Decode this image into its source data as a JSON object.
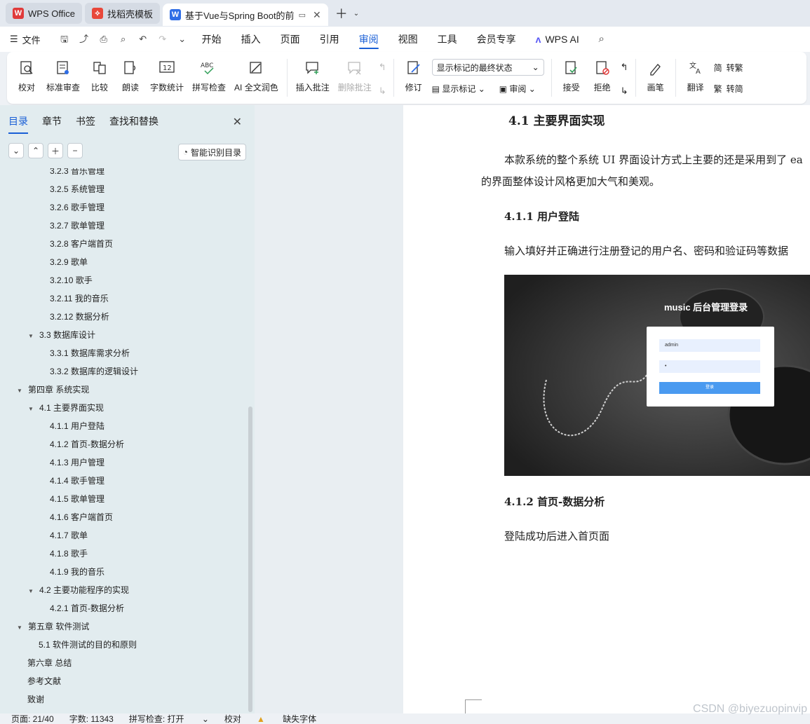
{
  "tabs": [
    {
      "label": "WPS Office",
      "icon": "wps-logo"
    },
    {
      "label": "找稻壳模板",
      "icon": "docer-logo"
    },
    {
      "label": "基于Vue与Spring Boot的前",
      "icon": "word-logo",
      "active": true
    }
  ],
  "menu": {
    "file": "文件",
    "items": [
      "开始",
      "插入",
      "页面",
      "引用",
      "审阅",
      "视图",
      "工具",
      "会员专享"
    ],
    "active": "审阅",
    "ai": "WPS AI"
  },
  "ribbon": {
    "proof": "校对",
    "standard_review": "标准审查",
    "compare": "比较",
    "read_aloud": "朗读",
    "word_count": "字数统计",
    "spell_check": "拼写检查",
    "ai_polish": "AI 全文润色",
    "insert_comment": "插入批注",
    "delete_comment": "删除批注",
    "track": "修订",
    "markup_select": "显示标记的最终状态",
    "show_markup": "显示标记",
    "review": "审阅",
    "accept": "接受",
    "reject": "拒绝",
    "pen": "画笔",
    "translate": "翻译",
    "to_traditional": "转繁",
    "to_simplified": "转简"
  },
  "nav": {
    "tabs": [
      "目录",
      "章节",
      "书签",
      "查找和替换"
    ],
    "active_tab": "目录",
    "smart_toc": "智能识别目录"
  },
  "toc": [
    {
      "label": "3.2.3 音乐管理",
      "level": 3
    },
    {
      "label": "3.2.5 系统管理",
      "level": 3
    },
    {
      "label": "3.2.6 歌手管理",
      "level": 3
    },
    {
      "label": "3.2.7 歌单管理",
      "level": 3
    },
    {
      "label": "3.2.8 客户端首页",
      "level": 3
    },
    {
      "label": "3.2.9 歌单",
      "level": 3
    },
    {
      "label": "3.2.10 歌手",
      "level": 3
    },
    {
      "label": "3.2.11 我的音乐",
      "level": 3
    },
    {
      "label": "3.2.12 数据分析",
      "level": 3
    },
    {
      "label": "3.3 数据库设计",
      "level": 2,
      "expanded": true
    },
    {
      "label": "3.3.1 数据库需求分析",
      "level": 3
    },
    {
      "label": "3.3.2 数据库的逻辑设计",
      "level": 3
    },
    {
      "label": "第四章  系统实现",
      "level": 1,
      "expanded": true
    },
    {
      "label": "4.1 主要界面实现",
      "level": 2,
      "expanded": true
    },
    {
      "label": "4.1.1 用户登陆",
      "level": 3
    },
    {
      "label": "4.1.2 首页-数据分析",
      "level": 3
    },
    {
      "label": "4.1.3 用户管理",
      "level": 3
    },
    {
      "label": "4.1.4 歌手管理",
      "level": 3
    },
    {
      "label": "4.1.5 歌单管理",
      "level": 3
    },
    {
      "label": "4.1.6 客户端首页",
      "level": 3
    },
    {
      "label": "4.1.7 歌单",
      "level": 3
    },
    {
      "label": "4.1.8 歌手",
      "level": 3
    },
    {
      "label": "4.1.9 我的音乐",
      "level": 3
    },
    {
      "label": "4.2 主要功能程序的实现",
      "level": 2,
      "expanded": true
    },
    {
      "label": "4.2.1 首页-数据分析",
      "level": 3
    },
    {
      "label": "第五章  软件测试",
      "level": 1,
      "expanded": true
    },
    {
      "label": "5.1 软件测试的目的和原则",
      "level": 2
    },
    {
      "label": "第六章  总结",
      "level": 1
    },
    {
      "label": "参考文献",
      "level": 1
    },
    {
      "label": "致谢",
      "level": 1
    }
  ],
  "document": {
    "h_41": "4.1 主要界面实现",
    "p1_line1": "本款系统的整个系统 UI 界面设计方式上主要的还是采用到了 ea",
    "p1_line2": "的界面整体设计风格更加大气和美观。",
    "h_411": "4.1.1 用户登陆",
    "p2": "输入填好并正确进行注册登记的用户名、密码和验证码等数据",
    "login_title": "music 后台管理登录",
    "login_user": "admin",
    "login_pass": "•",
    "login_button": "登录",
    "h_412": "4.1.2 首页-数据分析",
    "p3": "登陆成功后进入首页面"
  },
  "status": {
    "page": "页面: 21/40",
    "words": "字数: 11343",
    "spell": "拼写检查: 打开",
    "proof": "校对",
    "missing_font": "缺失字体"
  },
  "watermark": "CSDN @biyezuopinvip",
  "colors": {
    "accent": "#1a5fd6",
    "nav_bg": "#e2ecef"
  }
}
